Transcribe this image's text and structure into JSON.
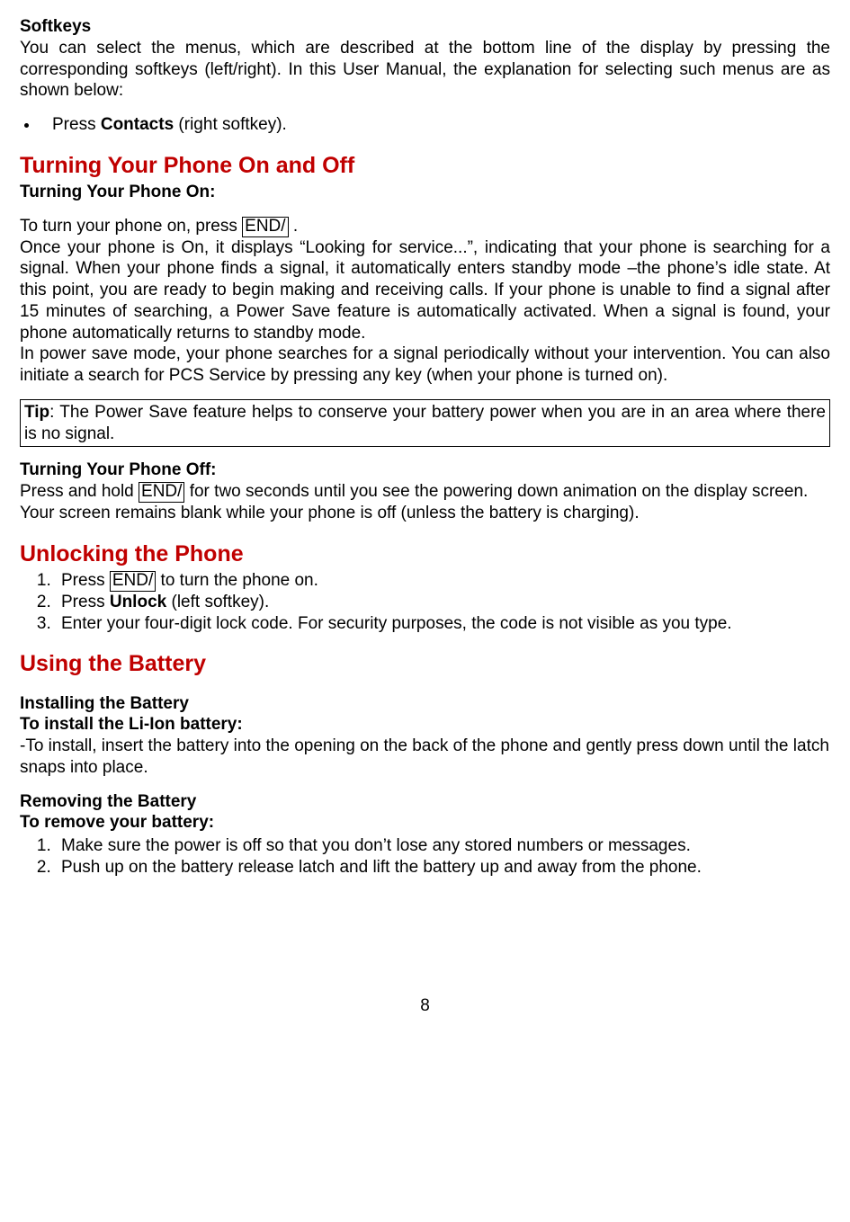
{
  "softkeys": {
    "heading": "Softkeys",
    "para": "You can select the menus, which are described at the bottom line of the display by pressing the corresponding softkeys (left/right). In this User Manual, the explanation for selecting such menus are as shown below:",
    "bullet_prefix": "Press ",
    "bullet_bold": "Contacts",
    "bullet_suffix": " (right softkey)."
  },
  "turning": {
    "heading": "Turning Your Phone On and Off",
    "on_sub": "Turning Your Phone On:",
    "on_p1_a": "To turn your phone on, press ",
    "key_label": "END/",
    "on_p1_b": " .",
    "on_p2": "Once your phone is On, it displays “Looking for service...”, indicating that your phone is searching for a signal. When your phone finds a signal, it automatically enters standby mode –the phone’s idle state. At this point, you are ready to begin making and receiving calls. If your phone is unable to find a signal after 15 minutes of searching, a Power Save feature is automatically activated. When a signal is found, your phone automatically returns to standby mode.",
    "on_p3": "In power save mode, your phone searches for a signal periodically without your intervention. You can also initiate a search for PCS Service by pressing any key (when your phone is turned on).",
    "tip_label": "Tip",
    "tip_body": ": The Power Save feature helps to conserve your battery power when you are in an area where there is no signal.",
    "off_sub": "Turning Your Phone Off:",
    "off_p1_a": "Press and hold ",
    "off_p1_b": " for two seconds until you see the powering down animation on the display screen. Your screen remains blank while your phone is off (unless the battery is charging)."
  },
  "unlocking": {
    "heading": "Unlocking the Phone",
    "step1_a": "Press ",
    "step1_b": " to turn the phone on.",
    "step2_a": "Press ",
    "step2_bold": "Unlock",
    "step2_b": " (left softkey).",
    "step3": "Enter your four-digit lock code. For security purposes, the code is not visible as you type."
  },
  "battery": {
    "heading": "Using the Battery",
    "install_sub1": "Installing the Battery",
    "install_sub2": "To install the Li-Ion battery:",
    "install_p": "-To install, insert the battery into the opening on the back of the phone and gently press down until the latch snaps into place.",
    "remove_sub1": "Removing the Battery",
    "remove_sub2": "To remove your battery:",
    "remove_step1": "Make sure the power is off so that you don’t lose any stored numbers or messages.",
    "remove_step2": "Push up on the battery release latch and lift the battery up and away from the phone."
  },
  "page_number": "8"
}
